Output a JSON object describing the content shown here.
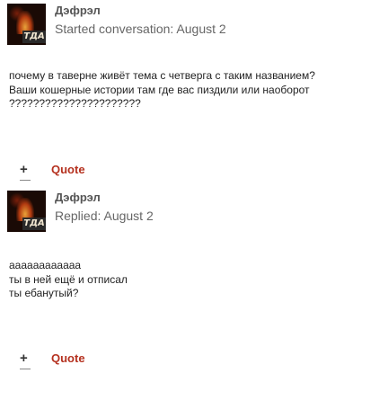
{
  "posts": [
    {
      "author": "Дэфрэл",
      "avatar_tag": "ТДА",
      "meta": "Started conversation: August 2",
      "lines": [
        "почему в таверне живёт тема с четверга с таким названием?",
        "Ваши кошерные истории там где вас пиздили или наоборот",
        "??????????????????????"
      ],
      "plus_label": "+",
      "quote_label": "Quote"
    },
    {
      "author": "Дэфрэл",
      "avatar_tag": "ТДА",
      "meta": "Replied: August 2",
      "lines": [
        "аааааааааааа",
        "ты в ней ещё и отписал",
        "ты ебанутый?"
      ],
      "plus_label": "+",
      "quote_label": "Quote"
    }
  ],
  "colors": {
    "quote_link": "#b5311f",
    "meta_text": "#666666",
    "author_text": "#555555"
  }
}
